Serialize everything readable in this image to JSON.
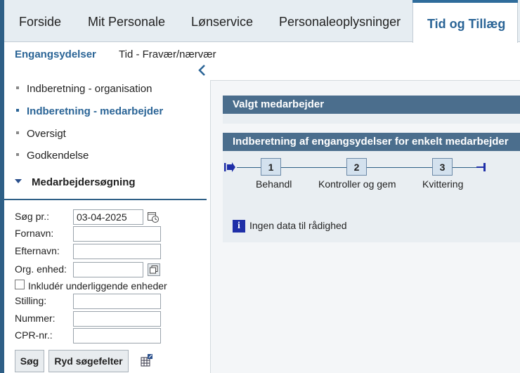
{
  "topnav": {
    "tabs": [
      {
        "label": "Forside"
      },
      {
        "label": "Mit Personale"
      },
      {
        "label": "Lønservice"
      },
      {
        "label": "Personaleoplysninger"
      },
      {
        "label": "Tid og Tillæg"
      }
    ],
    "active_index": 4
  },
  "subtabs": [
    {
      "label": "Engangsydelser"
    },
    {
      "label": "Tid - Fravær/nærvær"
    }
  ],
  "menu": {
    "items": [
      {
        "label": "Indberetning - organisation"
      },
      {
        "label": "Indberetning - medarbejder"
      },
      {
        "label": "Oversigt"
      },
      {
        "label": "Godkendelse"
      }
    ],
    "active_index": 1,
    "section_title": "Medarbejdersøgning"
  },
  "search_form": {
    "date_label": "Søg pr.:",
    "date_value": "03-04-2025",
    "firstname_label": "Fornavn:",
    "firstname_value": "",
    "lastname_label": "Efternavn:",
    "lastname_value": "",
    "org_label": "Org. enhed:",
    "org_value": "",
    "include_sub_label": "Inkludér underliggende enheder",
    "include_sub_checked": false,
    "position_label": "Stilling:",
    "position_value": "",
    "number_label": "Nummer:",
    "number_value": "",
    "cpr_label": "CPR-nr.:",
    "cpr_value": "",
    "search_button": "Søg",
    "reset_button": "Ryd søgefelter"
  },
  "main": {
    "selected_employee_title": "Valgt medarbejder",
    "report_title": "Indberetning af engangsydelser for enkelt medarbejder",
    "steps": [
      {
        "number": "1",
        "label": "Behandl"
      },
      {
        "number": "2",
        "label": "Kontroller og gem"
      },
      {
        "number": "3",
        "label": "Kvittering"
      }
    ],
    "info_message": "Ingen data til rådighed"
  },
  "icons": {
    "calendar": "calendar-icon",
    "org_picker": "org-picker-icon",
    "export": "export-icon",
    "info": "info-icon",
    "collapse": "chevron-left-icon",
    "section_toggle": "triangle-down-icon"
  },
  "colors": {
    "accent": "#2a6496",
    "panel_header": "#4b6e8d",
    "nav_bg": "#e6edf2",
    "step_fill": "#d3e1ee",
    "info_icon": "#1f2fa8"
  }
}
